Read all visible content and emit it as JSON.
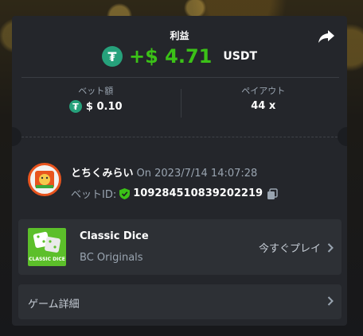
{
  "header": {
    "profit_label": "利益",
    "profit_amount": "+$ 4.71",
    "currency": "USDT"
  },
  "stats": {
    "bet_amount_label": "ベット額",
    "bet_amount_value": "$ 0.10",
    "payout_label": "ペイアウト",
    "payout_value": "44 x"
  },
  "user": {
    "name": "とちくみらい",
    "timestamp": "On 2023/7/14 14:07:28",
    "bet_id_label": "ベットID:",
    "bet_id": "109284510839202219"
  },
  "game": {
    "name": "Classic Dice",
    "provider": "BC Originals",
    "thumbnail_text": "CLASSIC DICE",
    "play_label": "今すぐプレイ"
  },
  "details": {
    "label": "ゲーム詳細"
  },
  "colors": {
    "profit_green": "#3bc117",
    "tether_green": "#26a17b",
    "card_bg": "#24262b",
    "panel_bg": "#2d3035"
  },
  "icons": [
    "tether-icon",
    "share-icon",
    "shield-check-icon",
    "copy-icon",
    "chevron-right-icon"
  ]
}
